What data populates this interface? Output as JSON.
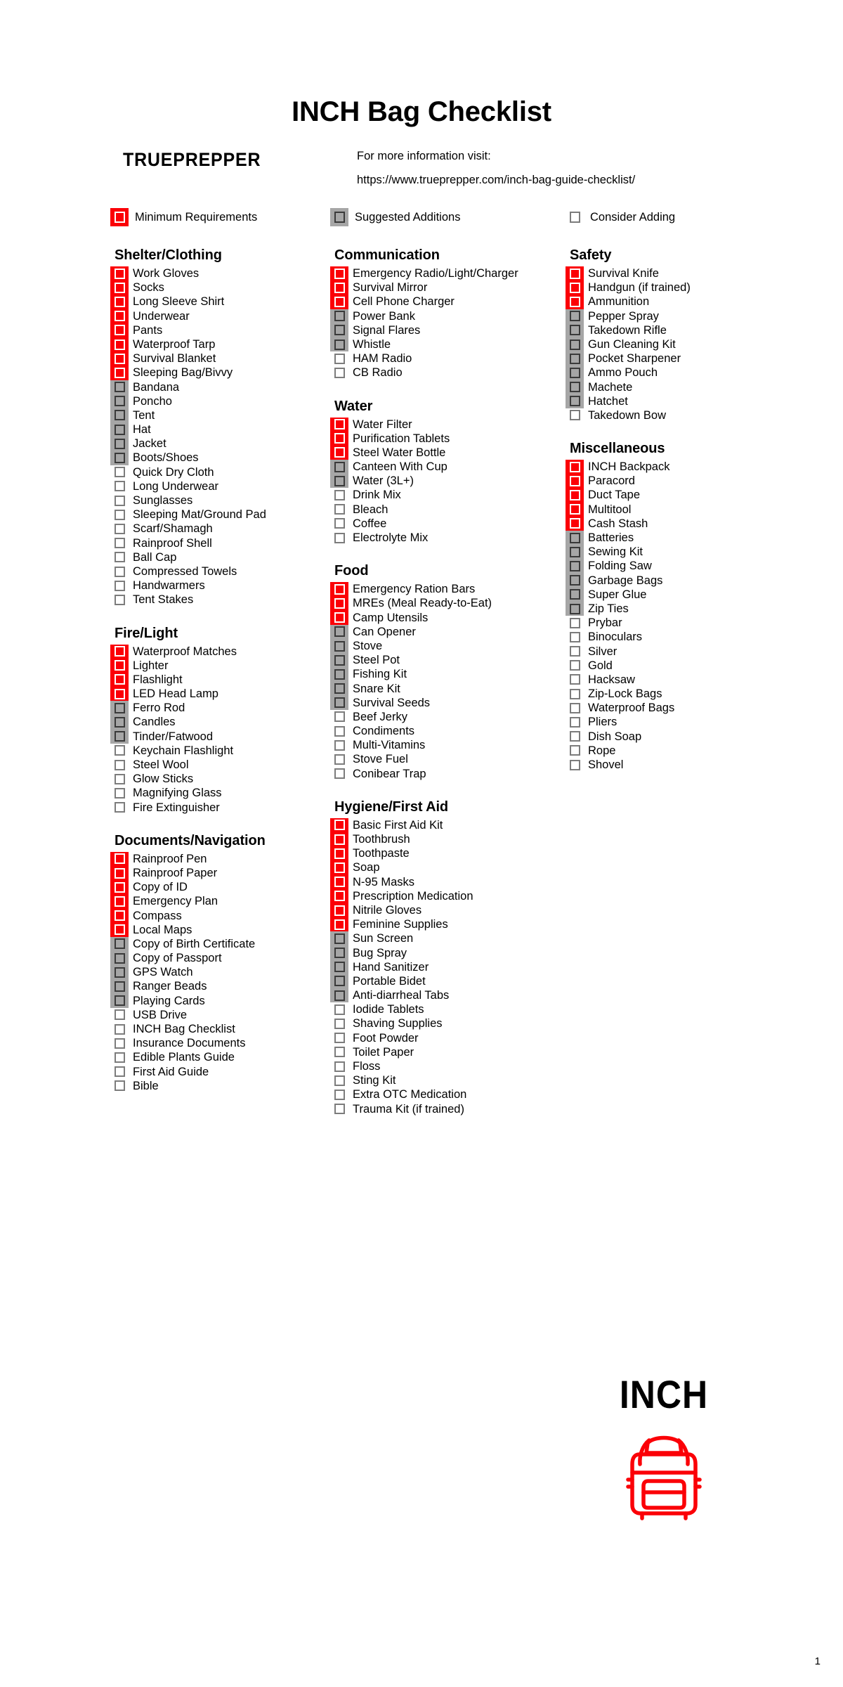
{
  "document": {
    "title": "INCH Bag Checklist",
    "brand": "TRUEPREPPER",
    "info_label": "For more information visit:",
    "info_url": "https://www.trueprepper.com/inch-bag-guide-checklist/",
    "page_number": "1",
    "logo_word": "INCH"
  },
  "colors": {
    "minimum": "#fb0007",
    "suggested": "#a6a6a6",
    "consider": "#ffffff",
    "text": "#000000",
    "background": "#ffffff"
  },
  "legend": [
    {
      "label": "Minimum Requirements",
      "state": "red"
    },
    {
      "label": "Suggested Additions",
      "state": "gray"
    },
    {
      "label": "Consider Adding",
      "state": "white"
    }
  ],
  "columns": [
    {
      "name": "column-1",
      "sections": [
        {
          "title": "Shelter/Clothing",
          "items": [
            {
              "label": "Work Gloves",
              "state": "red"
            },
            {
              "label": "Socks",
              "state": "red"
            },
            {
              "label": "Long Sleeve Shirt",
              "state": "red"
            },
            {
              "label": "Underwear",
              "state": "red"
            },
            {
              "label": "Pants",
              "state": "red"
            },
            {
              "label": "Waterproof Tarp",
              "state": "red"
            },
            {
              "label": "Survival Blanket",
              "state": "red"
            },
            {
              "label": "Sleeping Bag/Bivvy",
              "state": "red"
            },
            {
              "label": "Bandana",
              "state": "gray"
            },
            {
              "label": "Poncho",
              "state": "gray"
            },
            {
              "label": "Tent",
              "state": "gray"
            },
            {
              "label": "Hat",
              "state": "gray"
            },
            {
              "label": "Jacket",
              "state": "gray"
            },
            {
              "label": "Boots/Shoes",
              "state": "gray"
            },
            {
              "label": "Quick Dry Cloth",
              "state": "white"
            },
            {
              "label": "Long Underwear",
              "state": "white"
            },
            {
              "label": "Sunglasses",
              "state": "white"
            },
            {
              "label": "Sleeping Mat/Ground Pad",
              "state": "white"
            },
            {
              "label": "Scarf/Shamagh",
              "state": "white"
            },
            {
              "label": "Rainproof Shell",
              "state": "white"
            },
            {
              "label": "Ball Cap",
              "state": "white"
            },
            {
              "label": "Compressed Towels",
              "state": "white"
            },
            {
              "label": "Handwarmers",
              "state": "white"
            },
            {
              "label": "Tent Stakes",
              "state": "white"
            }
          ]
        },
        {
          "title": "Fire/Light",
          "items": [
            {
              "label": "Waterproof Matches",
              "state": "red"
            },
            {
              "label": "Lighter",
              "state": "red"
            },
            {
              "label": "Flashlight",
              "state": "red"
            },
            {
              "label": "LED Head Lamp",
              "state": "red"
            },
            {
              "label": "Ferro Rod",
              "state": "gray"
            },
            {
              "label": "Candles",
              "state": "gray"
            },
            {
              "label": "Tinder/Fatwood",
              "state": "gray"
            },
            {
              "label": "Keychain Flashlight",
              "state": "white"
            },
            {
              "label": "Steel Wool",
              "state": "white"
            },
            {
              "label": "Glow Sticks",
              "state": "white"
            },
            {
              "label": "Magnifying Glass",
              "state": "white"
            },
            {
              "label": "Fire Extinguisher",
              "state": "white"
            }
          ]
        },
        {
          "title": "Documents/Navigation",
          "items": [
            {
              "label": "Rainproof Pen",
              "state": "red"
            },
            {
              "label": "Rainproof Paper",
              "state": "red"
            },
            {
              "label": "Copy of ID",
              "state": "red"
            },
            {
              "label": "Emergency Plan",
              "state": "red"
            },
            {
              "label": "Compass",
              "state": "red"
            },
            {
              "label": "Local Maps",
              "state": "red"
            },
            {
              "label": "Copy of Birth Certificate",
              "state": "gray"
            },
            {
              "label": "Copy of Passport",
              "state": "gray"
            },
            {
              "label": "GPS Watch",
              "state": "gray"
            },
            {
              "label": "Ranger Beads",
              "state": "gray"
            },
            {
              "label": "Playing Cards",
              "state": "gray"
            },
            {
              "label": "USB Drive",
              "state": "white"
            },
            {
              "label": "INCH Bag Checklist",
              "state": "white"
            },
            {
              "label": "Insurance Documents",
              "state": "white"
            },
            {
              "label": "Edible Plants Guide",
              "state": "white"
            },
            {
              "label": "First Aid Guide",
              "state": "white"
            },
            {
              "label": "Bible",
              "state": "white"
            }
          ]
        }
      ]
    },
    {
      "name": "column-2",
      "sections": [
        {
          "title": "Communication",
          "items": [
            {
              "label": "Emergency Radio/Light/Charger",
              "state": "red"
            },
            {
              "label": "Survival Mirror",
              "state": "red"
            },
            {
              "label": "Cell Phone Charger",
              "state": "red"
            },
            {
              "label": "Power Bank",
              "state": "gray"
            },
            {
              "label": "Signal Flares",
              "state": "gray"
            },
            {
              "label": "Whistle",
              "state": "gray"
            },
            {
              "label": "HAM Radio",
              "state": "white"
            },
            {
              "label": "CB Radio",
              "state": "white"
            }
          ]
        },
        {
          "title": "Water",
          "items": [
            {
              "label": "Water Filter",
              "state": "red"
            },
            {
              "label": "Purification Tablets",
              "state": "red"
            },
            {
              "label": "Steel Water Bottle",
              "state": "red"
            },
            {
              "label": "Canteen With Cup",
              "state": "gray"
            },
            {
              "label": "Water (3L+)",
              "state": "gray"
            },
            {
              "label": "Drink Mix",
              "state": "white"
            },
            {
              "label": "Bleach",
              "state": "white"
            },
            {
              "label": "Coffee",
              "state": "white"
            },
            {
              "label": "Electrolyte Mix",
              "state": "white"
            }
          ]
        },
        {
          "title": "Food",
          "items": [
            {
              "label": "Emergency Ration Bars",
              "state": "red"
            },
            {
              "label": "MREs (Meal Ready-to-Eat)",
              "state": "red"
            },
            {
              "label": "Camp Utensils",
              "state": "red"
            },
            {
              "label": "Can Opener",
              "state": "gray"
            },
            {
              "label": "Stove",
              "state": "gray"
            },
            {
              "label": "Steel Pot",
              "state": "gray"
            },
            {
              "label": "Fishing Kit",
              "state": "gray"
            },
            {
              "label": "Snare Kit",
              "state": "gray"
            },
            {
              "label": "Survival Seeds",
              "state": "gray"
            },
            {
              "label": "Beef Jerky",
              "state": "white"
            },
            {
              "label": "Condiments",
              "state": "white"
            },
            {
              "label": "Multi-Vitamins",
              "state": "white"
            },
            {
              "label": "Stove Fuel",
              "state": "white"
            },
            {
              "label": "Conibear Trap",
              "state": "white"
            }
          ]
        },
        {
          "title": "Hygiene/First Aid",
          "items": [
            {
              "label": "Basic First Aid Kit",
              "state": "red"
            },
            {
              "label": "Toothbrush",
              "state": "red"
            },
            {
              "label": "Toothpaste",
              "state": "red"
            },
            {
              "label": "Soap",
              "state": "red"
            },
            {
              "label": "N-95 Masks",
              "state": "red"
            },
            {
              "label": "Prescription Medication",
              "state": "red"
            },
            {
              "label": "Nitrile Gloves",
              "state": "red"
            },
            {
              "label": "Feminine Supplies",
              "state": "red"
            },
            {
              "label": "Sun Screen",
              "state": "gray"
            },
            {
              "label": "Bug Spray",
              "state": "gray"
            },
            {
              "label": "Hand Sanitizer",
              "state": "gray"
            },
            {
              "label": "Portable Bidet",
              "state": "gray"
            },
            {
              "label": "Anti-diarrheal Tabs",
              "state": "gray"
            },
            {
              "label": "Iodide Tablets",
              "state": "white"
            },
            {
              "label": "Shaving Supplies",
              "state": "white"
            },
            {
              "label": "Foot Powder",
              "state": "white"
            },
            {
              "label": "Toilet Paper",
              "state": "white"
            },
            {
              "label": "Floss",
              "state": "white"
            },
            {
              "label": "Sting Kit",
              "state": "white"
            },
            {
              "label": "Extra OTC Medication",
              "state": "white"
            },
            {
              "label": "Trauma Kit (if trained)",
              "state": "white"
            }
          ]
        }
      ]
    },
    {
      "name": "column-3",
      "sections": [
        {
          "title": "Safety",
          "items": [
            {
              "label": "Survival Knife",
              "state": "red"
            },
            {
              "label": "Handgun (if trained)",
              "state": "red"
            },
            {
              "label": "Ammunition",
              "state": "red"
            },
            {
              "label": "Pepper Spray",
              "state": "gray"
            },
            {
              "label": "Takedown Rifle",
              "state": "gray"
            },
            {
              "label": "Gun Cleaning Kit",
              "state": "gray"
            },
            {
              "label": "Pocket Sharpener",
              "state": "gray"
            },
            {
              "label": "Ammo Pouch",
              "state": "gray"
            },
            {
              "label": "Machete",
              "state": "gray"
            },
            {
              "label": "Hatchet",
              "state": "gray"
            },
            {
              "label": "Takedown Bow",
              "state": "white"
            }
          ]
        },
        {
          "title": "Miscellaneous",
          "items": [
            {
              "label": "INCH Backpack",
              "state": "red"
            },
            {
              "label": "Paracord",
              "state": "red"
            },
            {
              "label": "Duct Tape",
              "state": "red"
            },
            {
              "label": "Multitool",
              "state": "red"
            },
            {
              "label": "Cash Stash",
              "state": "red"
            },
            {
              "label": "Batteries",
              "state": "gray"
            },
            {
              "label": "Sewing Kit",
              "state": "gray"
            },
            {
              "label": "Folding Saw",
              "state": "gray"
            },
            {
              "label": "Garbage Bags",
              "state": "gray"
            },
            {
              "label": "Super Glue",
              "state": "gray"
            },
            {
              "label": "Zip Ties",
              "state": "gray"
            },
            {
              "label": "Prybar",
              "state": "white"
            },
            {
              "label": "Binoculars",
              "state": "white"
            },
            {
              "label": "Silver",
              "state": "white"
            },
            {
              "label": "Gold",
              "state": "white"
            },
            {
              "label": "Hacksaw",
              "state": "white"
            },
            {
              "label": "Zip-Lock Bags",
              "state": "white"
            },
            {
              "label": "Waterproof Bags",
              "state": "white"
            },
            {
              "label": "Pliers",
              "state": "white"
            },
            {
              "label": "Dish Soap",
              "state": "white"
            },
            {
              "label": "Rope",
              "state": "white"
            },
            {
              "label": "Shovel",
              "state": "white"
            }
          ]
        }
      ]
    }
  ]
}
